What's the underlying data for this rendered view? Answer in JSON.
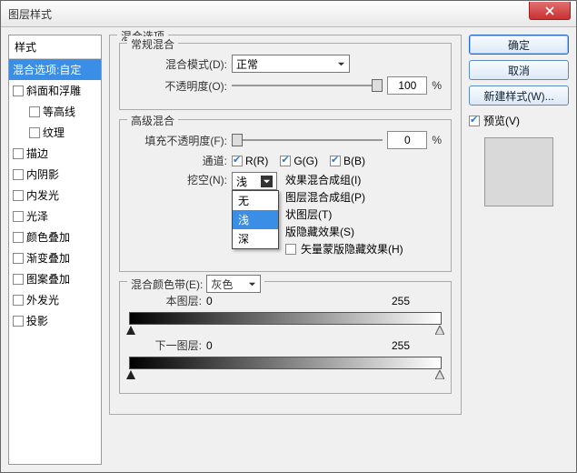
{
  "title": "图层样式",
  "left": {
    "header": "样式",
    "selected": "混合选项:自定",
    "items": [
      {
        "label": "斜面和浮雕",
        "sub": false
      },
      {
        "label": "等高线",
        "sub": true
      },
      {
        "label": "纹理",
        "sub": true
      },
      {
        "label": "描边",
        "sub": false
      },
      {
        "label": "内阴影",
        "sub": false
      },
      {
        "label": "内发光",
        "sub": false
      },
      {
        "label": "光泽",
        "sub": false
      },
      {
        "label": "颜色叠加",
        "sub": false
      },
      {
        "label": "渐变叠加",
        "sub": false
      },
      {
        "label": "图案叠加",
        "sub": false
      },
      {
        "label": "外发光",
        "sub": false
      },
      {
        "label": "投影",
        "sub": false
      }
    ]
  },
  "mix": {
    "group": "混合选项",
    "normal_group": "常规混合",
    "mode_label": "混合模式(D):",
    "mode_value": "正常",
    "opacity_label": "不透明度(O):",
    "opacity_value": "100",
    "pct": "%",
    "adv_group": "高级混合",
    "fill_label": "填充不透明度(F):",
    "fill_value": "0",
    "chan_label": "通道:",
    "chan_r": "R(R)",
    "chan_g": "G(G)",
    "chan_b": "B(B)",
    "knock_label": "挖空(N):",
    "knock_value": "浅",
    "knock_options": [
      "无",
      "浅",
      "深"
    ],
    "adv_checks": [
      "效果混合成组(I)",
      "图层混合成组(P)",
      "状图层(T)",
      "版隐藏效果(S)",
      "矢量蒙版隐藏效果(H)"
    ],
    "blendif_group": "混合颜色带(E):",
    "blendif_value": "灰色",
    "this_label": "本图层:",
    "under_label": "下一图层:",
    "v0": "0",
    "v255": "255"
  },
  "right": {
    "ok": "确定",
    "cancel": "取消",
    "newstyle": "新建样式(W)...",
    "preview": "预览(V)"
  }
}
